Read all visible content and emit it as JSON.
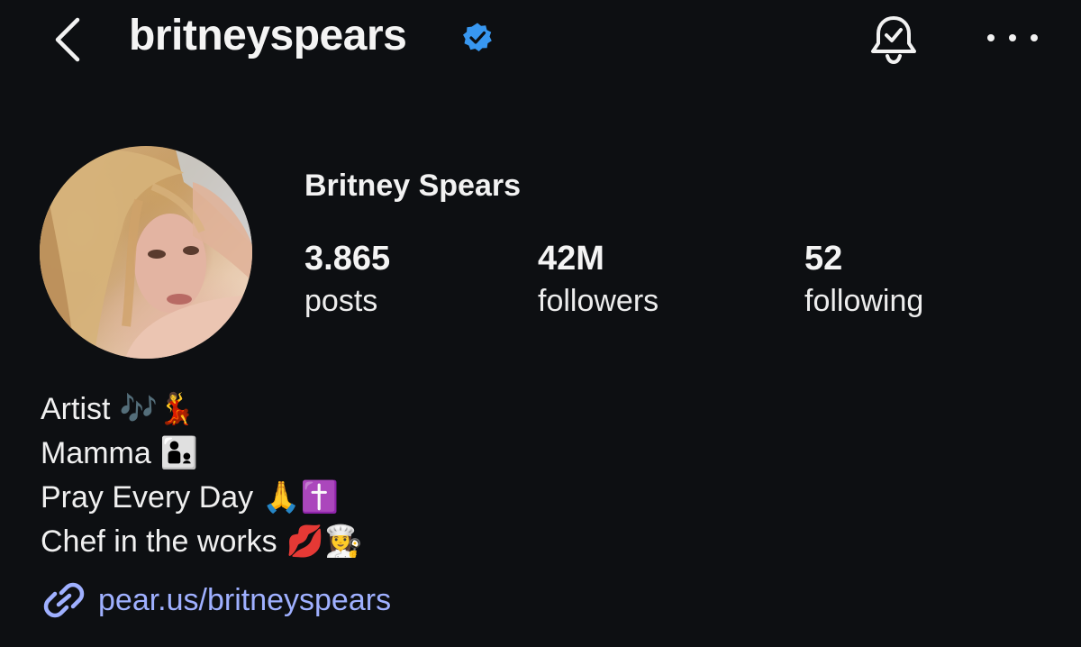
{
  "header": {
    "username": "britneyspears",
    "verified": true,
    "back_icon": "chevron-left-icon",
    "bell_icon": "bell-check-icon",
    "more_icon": "more-horizontal-icon"
  },
  "profile": {
    "full_name": "Britney Spears",
    "avatar_icon": "profile-photo"
  },
  "stats": {
    "posts": {
      "value": "3.865",
      "label": "posts"
    },
    "followers": {
      "value": "42M",
      "label": "followers"
    },
    "following": {
      "value": "52",
      "label": "following"
    }
  },
  "bio": {
    "lines": [
      {
        "text": "Artist",
        "emoji": "🎶💃"
      },
      {
        "text": "Mamma",
        "emoji": "👨‍👦"
      },
      {
        "text": "Pray Every Day",
        "emoji": "🙏✝️"
      },
      {
        "text": "Chef in the works",
        "emoji": "💋👩‍🍳"
      }
    ]
  },
  "link": {
    "icon": "link-icon",
    "text": "pear.us/britneyspears"
  },
  "colors": {
    "background": "#0d0f12",
    "text": "#f2f2f2",
    "link": "#9fb0ff",
    "verified": "#3897f0"
  }
}
